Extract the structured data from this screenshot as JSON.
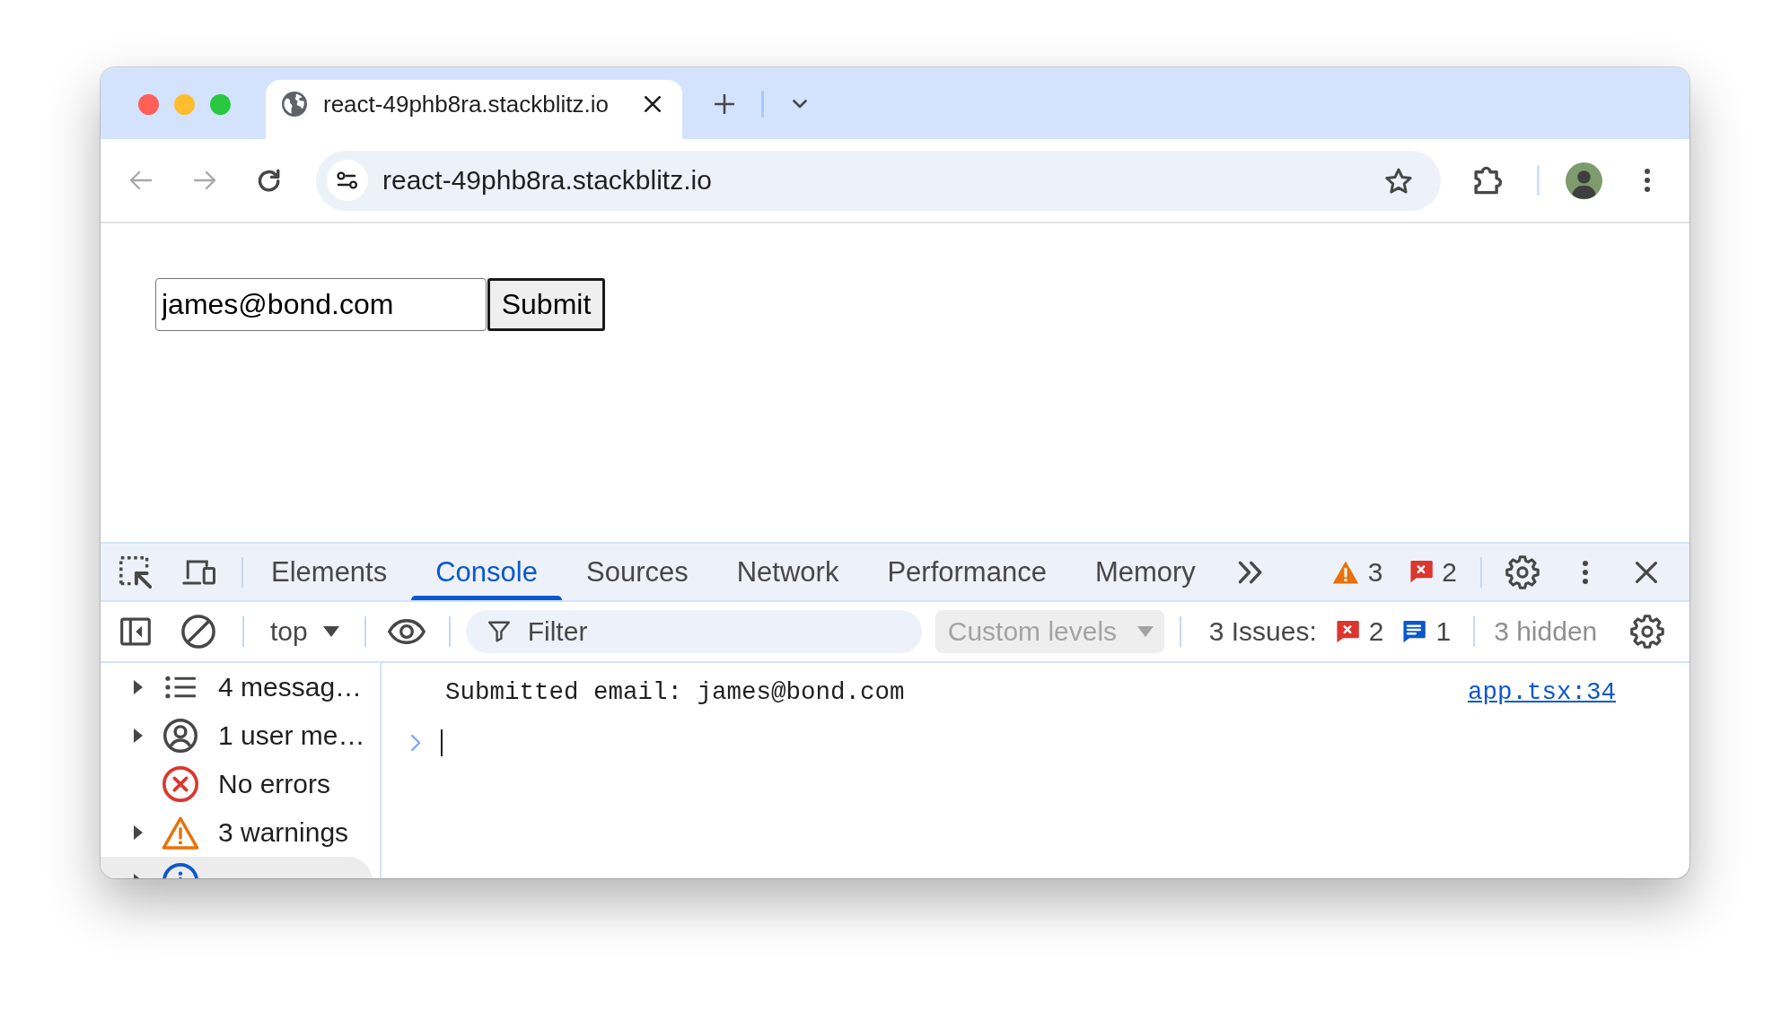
{
  "browser": {
    "tabs": [
      {
        "title": "react-49phb8ra.stackblitz.io",
        "selected": true
      }
    ],
    "toolbar": {
      "back": {
        "disabled": true
      },
      "forward": {
        "disabled": true
      },
      "url": "react-49phb8ra.stackblitz.io"
    }
  },
  "page": {
    "email_field": {
      "value": "james@bond.com"
    },
    "submit_button": {
      "label": "Submit"
    }
  },
  "devtools": {
    "tabs": [
      {
        "label": "Elements",
        "selected": false
      },
      {
        "label": "Console",
        "selected": true
      },
      {
        "label": "Sources",
        "selected": false
      },
      {
        "label": "Network",
        "selected": false
      },
      {
        "label": "Performance",
        "selected": false
      },
      {
        "label": "Memory",
        "selected": false
      }
    ],
    "counters": [
      {
        "kind": "warning",
        "count": "3"
      },
      {
        "kind": "error",
        "count": "2"
      }
    ],
    "console_toolbar": {
      "context": "top",
      "filter": {
        "placeholder": "Filter"
      },
      "levels": {
        "label": "Custom levels",
        "disabled": true
      },
      "issues": {
        "label": "3 Issues:",
        "counts": [
          {
            "kind": "error",
            "count": "2"
          },
          {
            "kind": "info",
            "count": "1"
          }
        ]
      },
      "hidden": "3 hidden"
    },
    "sidebar": {
      "items": [
        {
          "kind": "messages",
          "label": "4 messag…",
          "expandable": true,
          "selected": false
        },
        {
          "kind": "user",
          "label": "1 user me…",
          "expandable": true,
          "selected": false
        },
        {
          "kind": "error",
          "label": "No errors",
          "expandable": false,
          "selected": false
        },
        {
          "kind": "warning",
          "label": "3 warnings",
          "expandable": true,
          "selected": false
        },
        {
          "kind": "info",
          "expandable": true,
          "selected": true
        }
      ]
    },
    "console": {
      "messages": [
        {
          "text": "Submitted email: james@bond.com",
          "source": "app.tsx:34"
        }
      ]
    }
  }
}
